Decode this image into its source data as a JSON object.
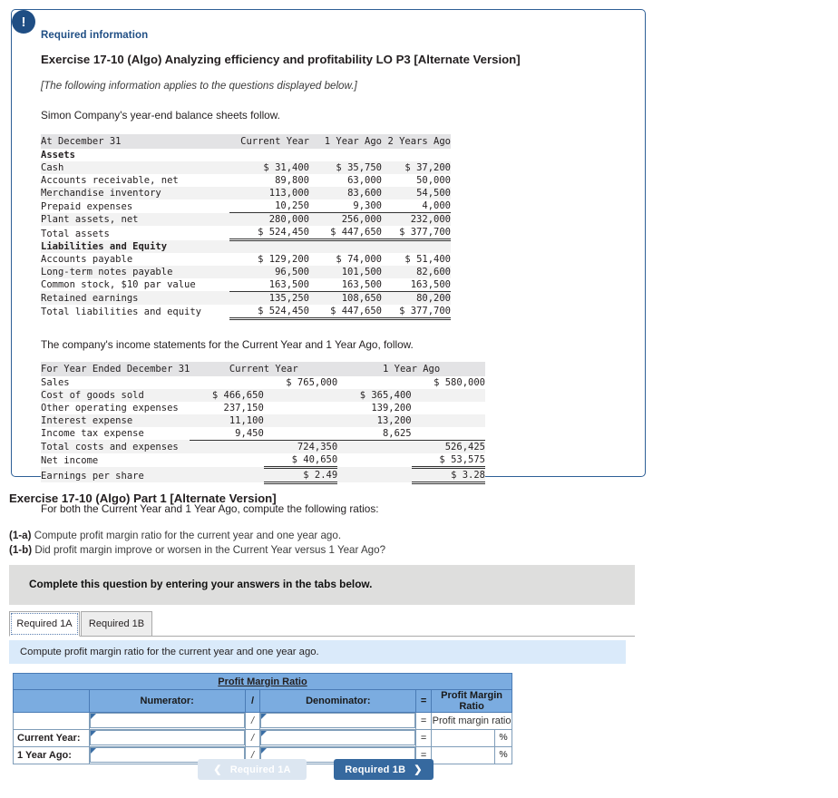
{
  "card": {
    "alert_icon": "exclamation-icon",
    "required_label": "Required information",
    "exercise_title": "Exercise 17-10 (Algo) Analyzing efficiency and profitability LO P3 [Alternate Version]",
    "applies_note": "[The following information applies to the questions displayed below.]",
    "intro_line": "Simon Company's year-end balance sheets follow.",
    "income_intro": "The company's income statements for the Current Year and 1 Year Ago, follow.",
    "closing_line": "For both the Current Year and 1 Year Ago, compute the following ratios:"
  },
  "balance_sheet": {
    "header": [
      "At December 31",
      "Current Year",
      "1 Year Ago",
      "2 Years Ago"
    ],
    "section_assets": "Assets",
    "assets_rows": [
      {
        "label": "Cash",
        "values": [
          "$ 31,400",
          "$ 35,750",
          "$ 37,200"
        ]
      },
      {
        "label": "Accounts receivable, net",
        "values": [
          "89,800",
          "63,000",
          "50,000"
        ]
      },
      {
        "label": "Merchandise inventory",
        "values": [
          "113,000",
          "83,600",
          "54,500"
        ]
      },
      {
        "label": "Prepaid expenses",
        "values": [
          "10,250",
          "9,300",
          "4,000"
        ]
      },
      {
        "label": "Plant assets, net",
        "values": [
          "280,000",
          "256,000",
          "232,000"
        ]
      }
    ],
    "total_assets": {
      "label": "Total assets",
      "values": [
        "$ 524,450",
        "$ 447,650",
        "$ 377,700"
      ]
    },
    "section_liab": "Liabilities and Equity",
    "liab_rows": [
      {
        "label": "Accounts payable",
        "values": [
          "$ 129,200",
          "$ 74,000",
          "$ 51,400"
        ]
      },
      {
        "label": "Long-term notes payable",
        "values": [
          "96,500",
          "101,500",
          "82,600"
        ]
      },
      {
        "label": "Common stock, $10 par value",
        "values": [
          "163,500",
          "163,500",
          "163,500"
        ]
      },
      {
        "label": "Retained earnings",
        "values": [
          "135,250",
          "108,650",
          "80,200"
        ]
      }
    ],
    "total_liab": {
      "label": "Total liabilities and equity",
      "values": [
        "$ 524,450",
        "$ 447,650",
        "$ 377,700"
      ]
    }
  },
  "income_statement": {
    "header": [
      "For Year Ended December 31",
      "Current Year",
      "1 Year Ago"
    ],
    "sales": {
      "label": "Sales",
      "cy_total": "$ 765,000",
      "py_total": "$ 580,000"
    },
    "expense_rows": [
      {
        "label": "Cost of goods sold",
        "cy": "$ 466,650",
        "py": "$ 365,400"
      },
      {
        "label": "Other operating expenses",
        "cy": "237,150",
        "py": "139,200"
      },
      {
        "label": "Interest expense",
        "cy": "11,100",
        "py": "13,200"
      },
      {
        "label": "Income tax expense",
        "cy": "9,450",
        "py": "8,625"
      }
    ],
    "total_costs": {
      "label": "Total costs and expenses",
      "cy_total": "724,350",
      "py_total": "526,425"
    },
    "net_income": {
      "label": "Net income",
      "cy_total": "$ 40,650",
      "py_total": "$ 53,575"
    },
    "eps": {
      "label": "Earnings per share",
      "cy_total": "$ 2.49",
      "py_total": "$ 3.28"
    }
  },
  "part": {
    "title": "Exercise 17-10 (Algo) Part 1 [Alternate Version]",
    "q1a_tag": "(1-a)",
    "q1a_text": "Compute profit margin ratio for the current year and one year ago.",
    "q1b_tag": "(1-b)",
    "q1b_text": "Did profit margin improve or worsen in the Current Year versus 1 Year Ago?"
  },
  "banner": {
    "text": "Complete this question by entering your answers in the tabs below."
  },
  "tabs": [
    {
      "label": "Required 1A",
      "active": true
    },
    {
      "label": "Required 1B",
      "active": false
    }
  ],
  "instruction": {
    "text": "Compute profit margin ratio for the current year and one year ago."
  },
  "answer_table": {
    "title": "Profit Margin Ratio",
    "columns": {
      "blank": "",
      "numerator": "Numerator:",
      "slash": "/",
      "denominator": "Denominator:",
      "equals": "=",
      "result": "Profit Margin Ratio"
    },
    "rows": [
      {
        "label": "",
        "numerator": "",
        "op": "/",
        "denominator": "",
        "eq": "=",
        "result_text": "Profit margin ratio",
        "result_value": "",
        "suffix": ""
      },
      {
        "label": "Current Year:",
        "numerator": "",
        "op": "/",
        "denominator": "",
        "eq": "=",
        "result_text": "",
        "result_value": "",
        "suffix": "%"
      },
      {
        "label": "1 Year Ago:",
        "numerator": "",
        "op": "/",
        "denominator": "",
        "eq": "=",
        "result_text": "",
        "result_value": "",
        "suffix": "%"
      }
    ]
  },
  "nav": {
    "prev_label": "Required 1A",
    "prev_icon": "chevron-left-icon",
    "next_label": "Required 1B",
    "next_icon": "chevron-right-icon"
  },
  "colors": {
    "card_border": "#2e5f96",
    "accent_blue": "#1f4e84",
    "table_header": "#7bace0",
    "banner_gray": "#dededd",
    "instruction_blue": "#daeafa",
    "next_button": "#36699f",
    "prev_button": "#dce6f1"
  }
}
